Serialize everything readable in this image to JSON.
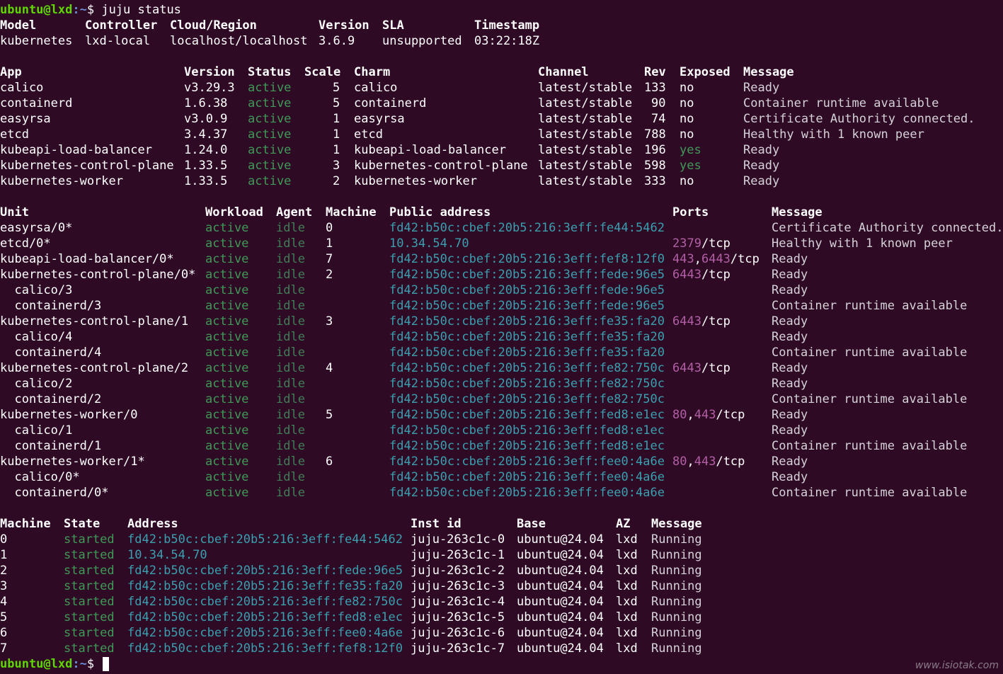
{
  "prompt": {
    "user_host": "ubuntu@lxd",
    "path": ":~",
    "symbol": "$",
    "command": "juju status"
  },
  "model": {
    "headers": [
      "Model",
      "Controller",
      "Cloud/Region",
      "Version",
      "SLA",
      "Timestamp"
    ],
    "values": [
      "kubernetes",
      "lxd-local",
      "localhost/localhost",
      "3.6.9",
      "unsupported",
      "03:22:18Z"
    ]
  },
  "apps": {
    "headers": [
      "App",
      "Version",
      "Status",
      "Scale",
      "Charm",
      "Channel",
      "Rev",
      "Exposed",
      "Message"
    ],
    "rows": [
      [
        "calico",
        "v3.29.3",
        "active",
        "5",
        "calico",
        "latest/stable",
        "133",
        "no",
        "Ready"
      ],
      [
        "containerd",
        "1.6.38",
        "active",
        "5",
        "containerd",
        "latest/stable",
        "90",
        "no",
        "Container runtime available"
      ],
      [
        "easyrsa",
        "v3.0.9",
        "active",
        "1",
        "easyrsa",
        "latest/stable",
        "74",
        "no",
        "Certificate Authority connected."
      ],
      [
        "etcd",
        "3.4.37",
        "active",
        "1",
        "etcd",
        "latest/stable",
        "788",
        "no",
        "Healthy with 1 known peer"
      ],
      [
        "kubeapi-load-balancer",
        "1.24.0",
        "active",
        "1",
        "kubeapi-load-balancer",
        "latest/stable",
        "196",
        "yes",
        "Ready"
      ],
      [
        "kubernetes-control-plane",
        "1.33.5",
        "active",
        "3",
        "kubernetes-control-plane",
        "latest/stable",
        "598",
        "yes",
        "Ready"
      ],
      [
        "kubernetes-worker",
        "1.33.5",
        "active",
        "2",
        "kubernetes-worker",
        "latest/stable",
        "333",
        "no",
        "Ready"
      ]
    ]
  },
  "units": {
    "headers": [
      "Unit",
      "Workload",
      "Agent",
      "Machine",
      "Public address",
      "Ports",
      "Message"
    ],
    "rows": [
      [
        "easyrsa/0*",
        "active",
        "idle",
        "0",
        "fd42:b50c:cbef:20b5:216:3eff:fe44:5462",
        "",
        "Certificate Authority connected."
      ],
      [
        "etcd/0*",
        "active",
        "idle",
        "1",
        "10.34.54.70",
        "2379/tcp",
        "Healthy with 1 known peer"
      ],
      [
        "kubeapi-load-balancer/0*",
        "active",
        "idle",
        "7",
        "fd42:b50c:cbef:20b5:216:3eff:fef8:12f0",
        "443,6443/tcp",
        "Ready"
      ],
      [
        "kubernetes-control-plane/0*",
        "active",
        "idle",
        "2",
        "fd42:b50c:cbef:20b5:216:3eff:fede:96e5",
        "6443/tcp",
        "Ready"
      ],
      [
        "  calico/3",
        "active",
        "idle",
        "",
        "fd42:b50c:cbef:20b5:216:3eff:fede:96e5",
        "",
        "Ready"
      ],
      [
        "  containerd/3",
        "active",
        "idle",
        "",
        "fd42:b50c:cbef:20b5:216:3eff:fede:96e5",
        "",
        "Container runtime available"
      ],
      [
        "kubernetes-control-plane/1",
        "active",
        "idle",
        "3",
        "fd42:b50c:cbef:20b5:216:3eff:fe35:fa20",
        "6443/tcp",
        "Ready"
      ],
      [
        "  calico/4",
        "active",
        "idle",
        "",
        "fd42:b50c:cbef:20b5:216:3eff:fe35:fa20",
        "",
        "Ready"
      ],
      [
        "  containerd/4",
        "active",
        "idle",
        "",
        "fd42:b50c:cbef:20b5:216:3eff:fe35:fa20",
        "",
        "Container runtime available"
      ],
      [
        "kubernetes-control-plane/2",
        "active",
        "idle",
        "4",
        "fd42:b50c:cbef:20b5:216:3eff:fe82:750c",
        "6443/tcp",
        "Ready"
      ],
      [
        "  calico/2",
        "active",
        "idle",
        "",
        "fd42:b50c:cbef:20b5:216:3eff:fe82:750c",
        "",
        "Ready"
      ],
      [
        "  containerd/2",
        "active",
        "idle",
        "",
        "fd42:b50c:cbef:20b5:216:3eff:fe82:750c",
        "",
        "Container runtime available"
      ],
      [
        "kubernetes-worker/0",
        "active",
        "idle",
        "5",
        "fd42:b50c:cbef:20b5:216:3eff:fed8:e1ec",
        "80,443/tcp",
        "Ready"
      ],
      [
        "  calico/1",
        "active",
        "idle",
        "",
        "fd42:b50c:cbef:20b5:216:3eff:fed8:e1ec",
        "",
        "Ready"
      ],
      [
        "  containerd/1",
        "active",
        "idle",
        "",
        "fd42:b50c:cbef:20b5:216:3eff:fed8:e1ec",
        "",
        "Container runtime available"
      ],
      [
        "kubernetes-worker/1*",
        "active",
        "idle",
        "6",
        "fd42:b50c:cbef:20b5:216:3eff:fee0:4a6e",
        "80,443/tcp",
        "Ready"
      ],
      [
        "  calico/0*",
        "active",
        "idle",
        "",
        "fd42:b50c:cbef:20b5:216:3eff:fee0:4a6e",
        "",
        "Ready"
      ],
      [
        "  containerd/0*",
        "active",
        "idle",
        "",
        "fd42:b50c:cbef:20b5:216:3eff:fee0:4a6e",
        "",
        "Container runtime available"
      ]
    ]
  },
  "machines": {
    "headers": [
      "Machine",
      "State",
      "Address",
      "Inst id",
      "Base",
      "AZ",
      "Message"
    ],
    "rows": [
      [
        "0",
        "started",
        "fd42:b50c:cbef:20b5:216:3eff:fe44:5462",
        "juju-263c1c-0",
        "ubuntu@24.04",
        "lxd",
        "Running"
      ],
      [
        "1",
        "started",
        "10.34.54.70",
        "juju-263c1c-1",
        "ubuntu@24.04",
        "lxd",
        "Running"
      ],
      [
        "2",
        "started",
        "fd42:b50c:cbef:20b5:216:3eff:fede:96e5",
        "juju-263c1c-2",
        "ubuntu@24.04",
        "lxd",
        "Running"
      ],
      [
        "3",
        "started",
        "fd42:b50c:cbef:20b5:216:3eff:fe35:fa20",
        "juju-263c1c-3",
        "ubuntu@24.04",
        "lxd",
        "Running"
      ],
      [
        "4",
        "started",
        "fd42:b50c:cbef:20b5:216:3eff:fe82:750c",
        "juju-263c1c-4",
        "ubuntu@24.04",
        "lxd",
        "Running"
      ],
      [
        "5",
        "started",
        "fd42:b50c:cbef:20b5:216:3eff:fed8:e1ec",
        "juju-263c1c-5",
        "ubuntu@24.04",
        "lxd",
        "Running"
      ],
      [
        "6",
        "started",
        "fd42:b50c:cbef:20b5:216:3eff:fee0:4a6e",
        "juju-263c1c-6",
        "ubuntu@24.04",
        "lxd",
        "Running"
      ],
      [
        "7",
        "started",
        "fd42:b50c:cbef:20b5:216:3eff:fef8:12f0",
        "juju-263c1c-7",
        "ubuntu@24.04",
        "lxd",
        "Running"
      ]
    ]
  },
  "watermark": "www.isiotak.com",
  "colors": {
    "background": "#2f0a24",
    "status_green": "#3f9a58",
    "port_magenta": "#b25fa6",
    "address_cyan": "#3a9fb0"
  }
}
